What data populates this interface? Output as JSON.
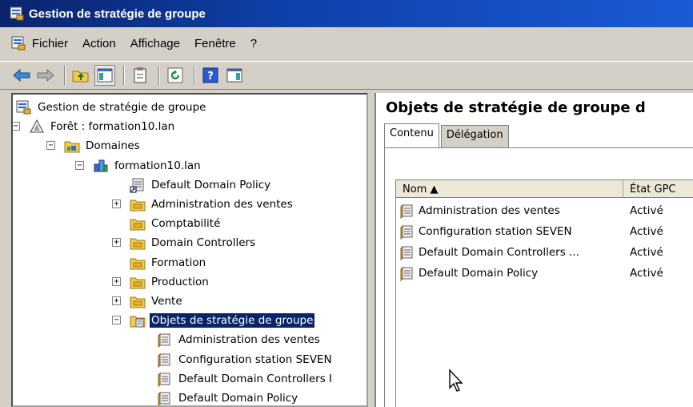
{
  "window": {
    "title": "Gestion de stratégie de groupe"
  },
  "menu": [
    "Fichier",
    "Action",
    "Affichage",
    "Fenêtre",
    "?"
  ],
  "toolbar": {
    "icons": [
      "back-arrow-icon",
      "forward-arrow-icon",
      "up-folder-icon",
      "show-hide-tree-icon",
      "properties-icon",
      "refresh-icon",
      "help-icon",
      "mmc-icon"
    ]
  },
  "tree": [
    {
      "label": "Gestion de stratégie de groupe",
      "icon": "gpm-icon",
      "level": 0,
      "expander": ""
    },
    {
      "label": "Forêt : formation10.lan",
      "icon": "forest-icon",
      "level": 1,
      "expander": "−"
    },
    {
      "label": "Domaines",
      "icon": "domains-icon",
      "level": 2,
      "expander": "−"
    },
    {
      "label": "formation10.lan",
      "icon": "domain-icon",
      "level": 3,
      "expander": "−"
    },
    {
      "label": "Default Domain Policy",
      "icon": "gpo-link-icon",
      "level": 4,
      "expander": ""
    },
    {
      "label": "Administration des ventes",
      "icon": "ou-folder-icon",
      "level": 4,
      "expander": "+"
    },
    {
      "label": "Comptabilité",
      "icon": "ou-folder-icon",
      "level": 4,
      "expander": ""
    },
    {
      "label": "Domain Controllers",
      "icon": "ou-folder-icon",
      "level": 4,
      "expander": "+"
    },
    {
      "label": "Formation",
      "icon": "ou-folder-icon",
      "level": 4,
      "expander": ""
    },
    {
      "label": "Production",
      "icon": "ou-folder-icon",
      "level": 4,
      "expander": "+"
    },
    {
      "label": "Vente",
      "icon": "ou-folder-icon",
      "level": 4,
      "expander": "+"
    },
    {
      "label": "Objets de stratégie de groupe",
      "icon": "gpo-container-icon",
      "level": 4,
      "expander": "−",
      "selected": true
    },
    {
      "label": "Administration des ventes",
      "icon": "gpo-icon",
      "level": 5,
      "expander": ""
    },
    {
      "label": "Configuration station SEVEN",
      "icon": "gpo-icon",
      "level": 5,
      "expander": ""
    },
    {
      "label": "Default Domain Controllers I",
      "icon": "gpo-icon",
      "level": 5,
      "expander": ""
    },
    {
      "label": "Default Domain Policy",
      "icon": "gpo-icon",
      "level": 5,
      "expander": ""
    }
  ],
  "right": {
    "title": "Objets de stratégie de groupe d",
    "tabs": [
      "Contenu",
      "Délégation"
    ],
    "active_tab": "Contenu",
    "columns": [
      "Nom ▲",
      "État GPC"
    ],
    "rows": [
      {
        "name": "Administration des ventes",
        "state": "Activé"
      },
      {
        "name": "Configuration station SEVEN",
        "state": "Activé"
      },
      {
        "name": "Default Domain Controllers ...",
        "state": "Activé"
      },
      {
        "name": "Default Domain Policy",
        "state": "Activé"
      }
    ]
  },
  "colors": {
    "title_bar": "#0a246a",
    "selection": "#0a246a",
    "chrome": "#d4d0c8"
  }
}
